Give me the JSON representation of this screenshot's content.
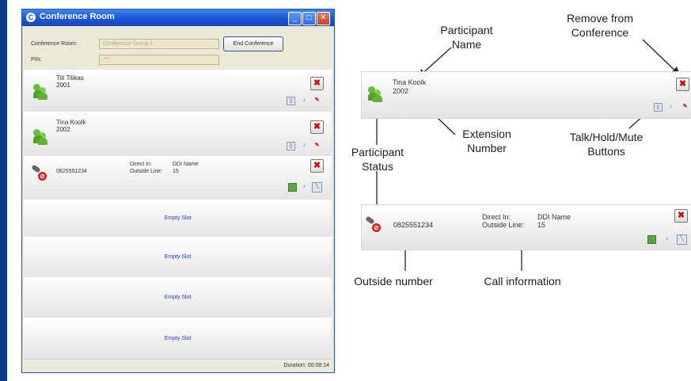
{
  "window": {
    "title": "Conference Room",
    "room_label": "Conference Room:",
    "room_value": "Conference Group 1",
    "pin_label": "PIN:",
    "pin_value": "***",
    "end_button": "End Conference",
    "duration_label": "Duration:",
    "duration_value": "00:08:14"
  },
  "slots": [
    {
      "name": "Tiit Tilikas",
      "ext": "2001",
      "status": "talk"
    },
    {
      "name": "Tina Koolk",
      "ext": "2002",
      "status": "talk"
    },
    {
      "number": "0825551234",
      "direct_label": "Direct In:",
      "direct_value": "DDI Name",
      "outside_label": "Outside Line:",
      "outside_value": "15",
      "status": "on-hold"
    },
    {
      "label": "Empty Slot"
    },
    {
      "label": "Empty Slot"
    },
    {
      "label": "Empty Slot"
    },
    {
      "label": "Empty Slot"
    }
  ],
  "callout": {
    "participant_name": "Participant\nName",
    "remove": "Remove from\nConference",
    "extension": "Extension\nNumber",
    "status": "Participant\nStatus",
    "talk_hold_mute": "Talk/Hold/Mute\nButtons",
    "outside_number": "Outside number",
    "call_info": "Call information",
    "example_name": "Tina Koolk",
    "example_ext": "2002",
    "example_number": "0825551234",
    "example_direct_label": "Direct In:",
    "example_direct_value": "DDI Name",
    "example_outside_label": "Outside Line:",
    "example_outside_value": "15"
  },
  "colors": {
    "titlebar": "#1a55d6",
    "accent_border": "#0b3c8c",
    "remove_red": "#cc1010",
    "empty_slot_text": "#2b3fc4"
  }
}
